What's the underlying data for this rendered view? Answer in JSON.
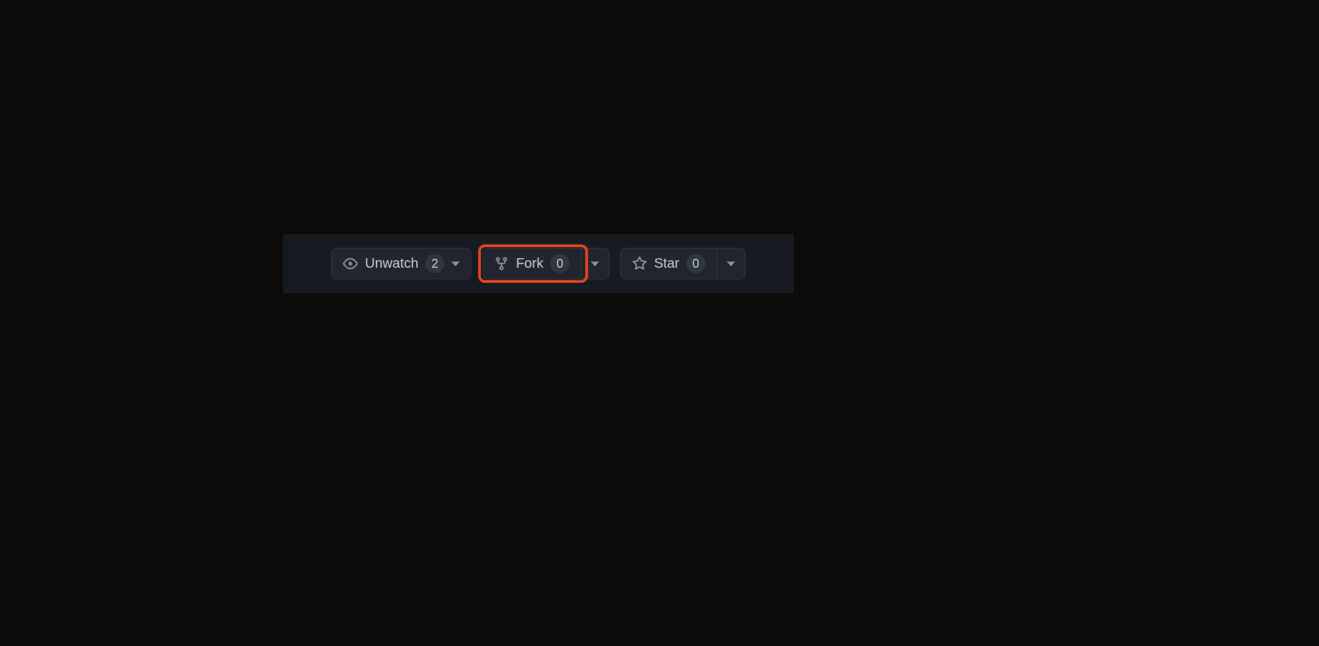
{
  "toolbar": {
    "watch": {
      "label": "Unwatch",
      "count": "2"
    },
    "fork": {
      "label": "Fork",
      "count": "0"
    },
    "star": {
      "label": "Star",
      "count": "0"
    }
  },
  "highlight": {
    "target": "fork-button"
  }
}
